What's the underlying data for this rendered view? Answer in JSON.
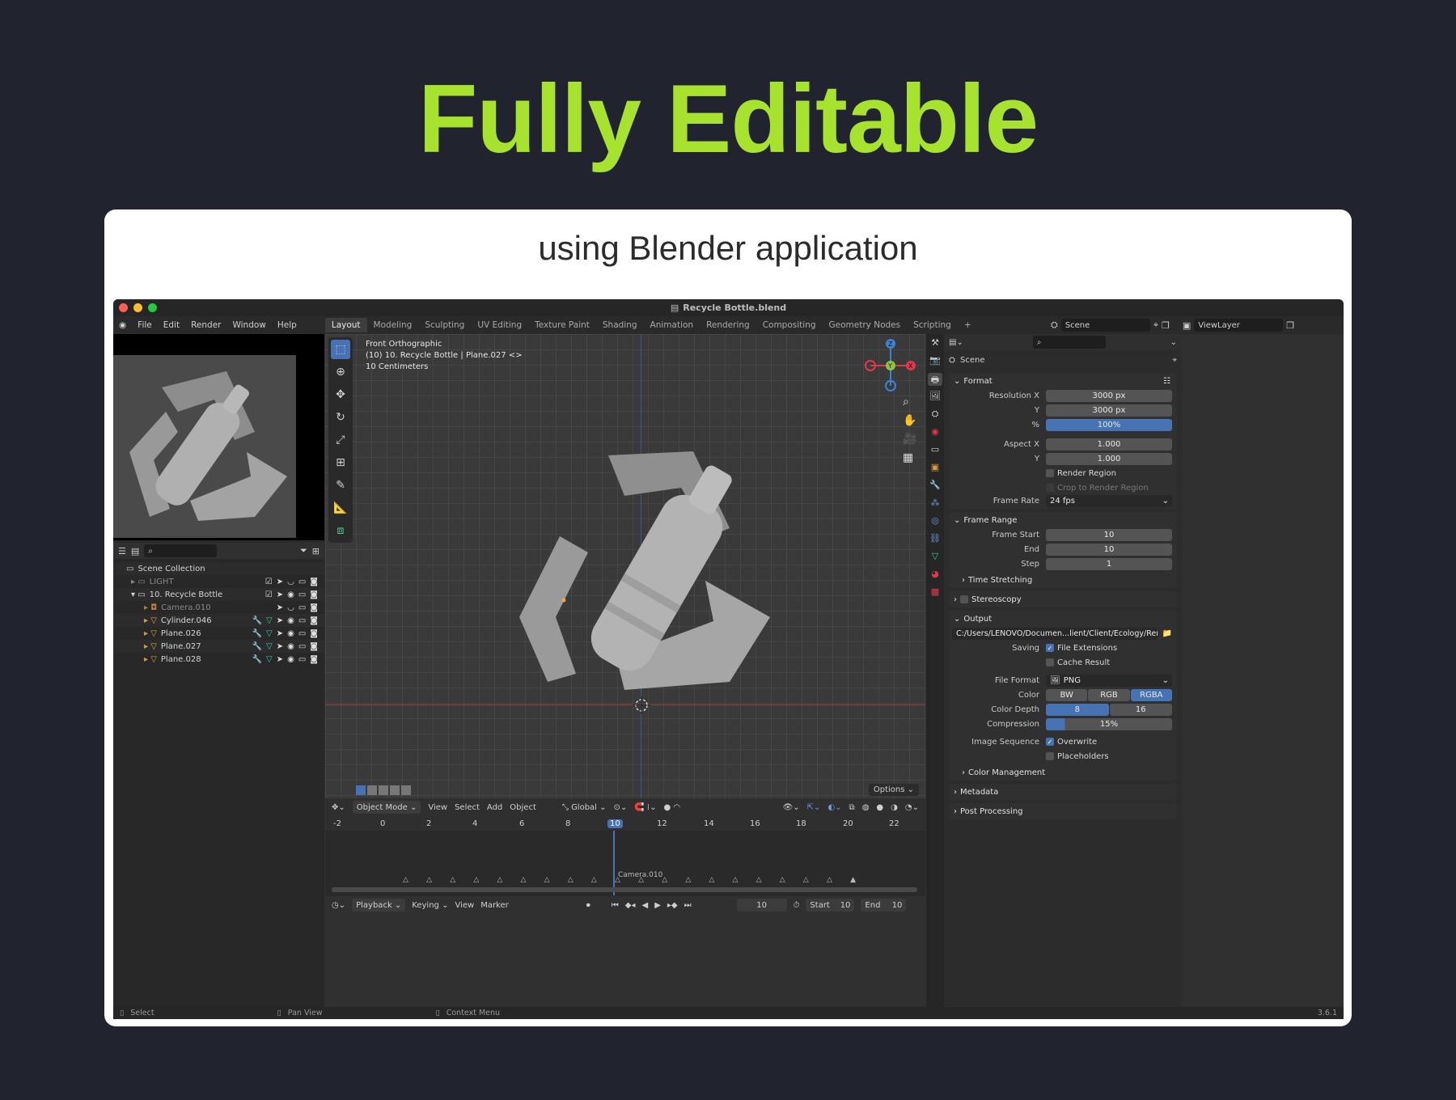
{
  "headline": "Fully Editable",
  "subtitle": "using Blender application",
  "window": {
    "title": "Recycle Bottle.blend"
  },
  "menu": [
    "File",
    "Edit",
    "Render",
    "Window",
    "Help"
  ],
  "workspaces": [
    "Layout",
    "Modeling",
    "Sculpting",
    "UV Editing",
    "Texture Paint",
    "Shading",
    "Animation",
    "Rendering",
    "Compositing",
    "Geometry Nodes",
    "Scripting"
  ],
  "scene": "Scene",
  "viewlayer": "ViewLayer",
  "viewport": {
    "line1": "Front Orthographic",
    "line2": "(10) 10. Recycle Bottle | Plane.027 <>",
    "line3": "10 Centimeters",
    "options": "Options"
  },
  "vpheader": {
    "mode": "Object Mode",
    "view": "View",
    "select": "Select",
    "add": "Add",
    "object": "Object",
    "orient": "Global"
  },
  "outliner": {
    "root": "Scene Collection",
    "rows": [
      {
        "name": "LIGHT",
        "type": "collection"
      },
      {
        "name": "10. Recycle Bottle",
        "type": "collection"
      },
      {
        "name": "Camera.010",
        "type": "camera"
      },
      {
        "name": "Cylinder.046",
        "type": "mesh"
      },
      {
        "name": "Plane.026",
        "type": "mesh"
      },
      {
        "name": "Plane.027",
        "type": "mesh"
      },
      {
        "name": "Plane.028",
        "type": "mesh"
      }
    ]
  },
  "timeline": {
    "frames": [
      "-2",
      "0",
      "2",
      "4",
      "6",
      "8",
      "10",
      "12",
      "14",
      "16",
      "18",
      "20",
      "22"
    ],
    "current": "10",
    "marker": "Camera.010",
    "playback": "Playback",
    "keying": "Keying",
    "view": "View",
    "marker_menu": "Marker",
    "frame": "10",
    "start_label": "Start",
    "start": "10",
    "end_label": "End",
    "end": "10"
  },
  "props": {
    "scene": "Scene",
    "format": {
      "title": "Format",
      "resx_label": "Resolution X",
      "resx": "3000 px",
      "resy_label": "Y",
      "resy": "3000 px",
      "pct_label": "%",
      "pct": "100%",
      "aspx_label": "Aspect X",
      "aspx": "1.000",
      "aspy_label": "Y",
      "aspy": "1.000",
      "render_region": "Render Region",
      "crop": "Crop to Render Region",
      "fr_label": "Frame Rate",
      "fr": "24 fps"
    },
    "range": {
      "title": "Frame Range",
      "start_label": "Frame Start",
      "start": "10",
      "end_label": "End",
      "end": "10",
      "step_label": "Step",
      "step": "1",
      "time_stretching": "Time Stretching"
    },
    "stereoscopy": "Stereoscopy",
    "output": {
      "title": "Output",
      "path": "C:/Users/LENOVO/Documen...lient/Client/Ecology/Render/",
      "saving_label": "Saving",
      "file_ext": "File Extensions",
      "cache": "Cache Result",
      "ff_label": "File Format",
      "ff": "PNG",
      "color_label": "Color",
      "color_opts": [
        "BW",
        "RGB",
        "RGBA"
      ],
      "depth_label": "Color Depth",
      "depth_opts": [
        "8",
        "16"
      ],
      "comp_label": "Compression",
      "comp": "15%",
      "imgseq_label": "Image Sequence",
      "overwrite": "Overwrite",
      "placeholders": "Placeholders",
      "color_mgmt": "Color Management"
    },
    "metadata": "Metadata",
    "post": "Post Processing"
  },
  "status": {
    "select": "Select",
    "pan": "Pan View",
    "context": "Context Menu",
    "version": "3.6.1"
  },
  "chart_data": null
}
